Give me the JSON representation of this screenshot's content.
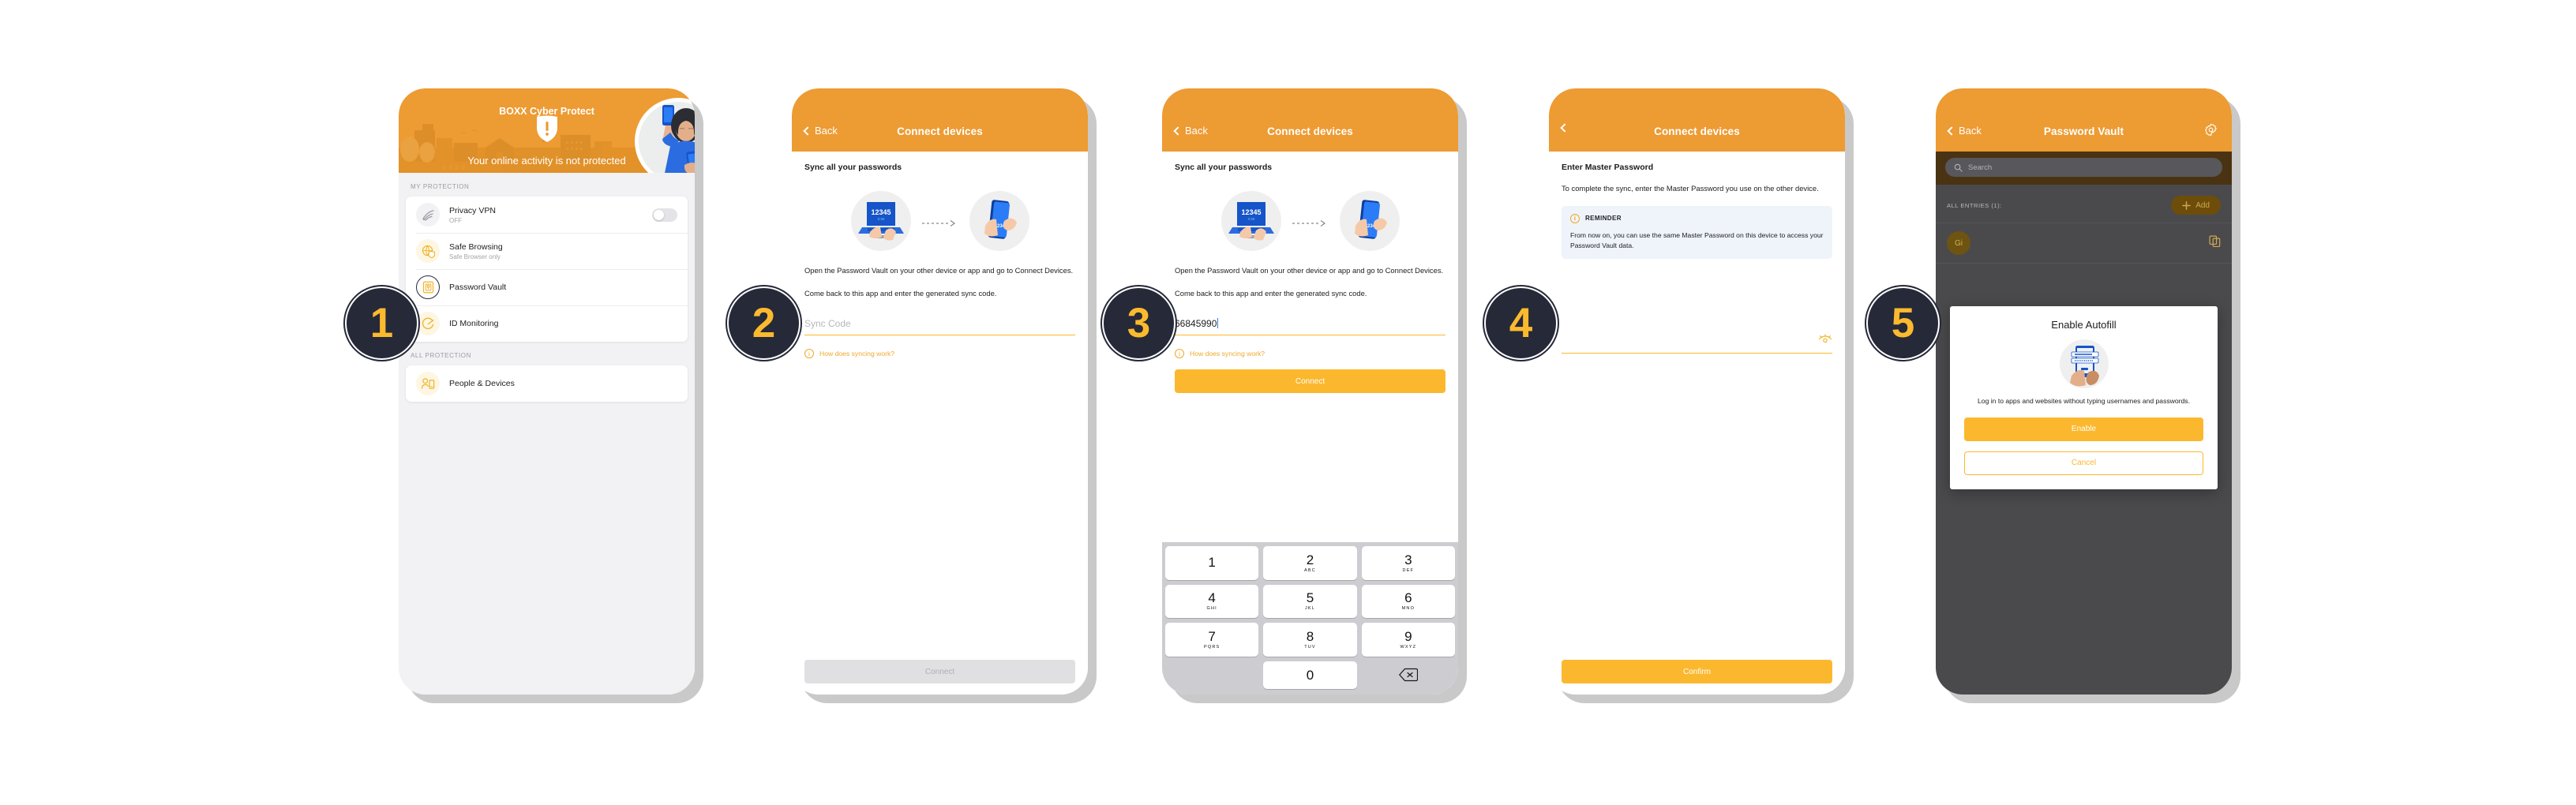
{
  "steps": [
    {
      "number": "1"
    },
    {
      "number": "2"
    },
    {
      "number": "3"
    },
    {
      "number": "4"
    },
    {
      "number": "5"
    }
  ],
  "screen1": {
    "hero_title": "BOXX Cyber Protect",
    "hero_status": "Your online activity is not protected",
    "section_my_protection": "MY PROTECTION",
    "section_all_protection": "ALL PROTECTION",
    "items": [
      {
        "title": "Privacy VPN",
        "subtitle": "OFF",
        "icon": "wifi-icon",
        "toggle": "off"
      },
      {
        "title": "Safe Browsing",
        "subtitle": "Safe Browser only",
        "icon": "globe-shield-icon"
      },
      {
        "title": "Password Vault",
        "subtitle": "",
        "icon": "vault-icon"
      },
      {
        "title": "ID Monitoring",
        "subtitle": "",
        "icon": "monitor-icon"
      }
    ],
    "all_items": [
      {
        "title": "People & Devices",
        "icon": "people-devices-icon"
      }
    ]
  },
  "screen2": {
    "nav_back": "Back",
    "nav_title": "Connect devices",
    "heading": "Sync all your passwords",
    "illustration_code": "12345",
    "illustration_timer": "0:59",
    "step_one": "Open the Password Vault on your other device or app and go to Connect Devices.",
    "step_two": "Come back to this app and enter the generated sync code.",
    "input_placeholder": "Sync Code",
    "input_value": "",
    "helper_link": "How does syncing work?",
    "cta": "Connect",
    "cta_state": "disabled"
  },
  "screen3": {
    "nav_back": "Back",
    "nav_title": "Connect devices",
    "heading": "Sync all your passwords",
    "illustration_code": "12345",
    "illustration_timer": "0:59",
    "step_one": "Open the Password Vault on your other device or app and go to Connect Devices.",
    "step_two": "Come back to this app and enter the generated sync code.",
    "input_value": "66845990",
    "helper_link": "How does syncing work?",
    "cta": "Connect",
    "cta_state": "enabled",
    "keypad": [
      {
        "num": "1",
        "letters": ""
      },
      {
        "num": "2",
        "letters": "ABC"
      },
      {
        "num": "3",
        "letters": "DEF"
      },
      {
        "num": "4",
        "letters": "GHI"
      },
      {
        "num": "5",
        "letters": "JKL"
      },
      {
        "num": "6",
        "letters": "MNO"
      },
      {
        "num": "7",
        "letters": "PQRS"
      },
      {
        "num": "8",
        "letters": "TUV"
      },
      {
        "num": "9",
        "letters": "WXYZ"
      },
      {
        "num": "0",
        "letters": ""
      }
    ],
    "keypad_delete_icon": "backspace-icon"
  },
  "screen4": {
    "nav_title": "Connect devices",
    "heading": "Enter Master Password",
    "body": "To complete the sync, enter the Master Password you use on the other device.",
    "reminder_label": "REMINDER",
    "reminder_body": "From now on, you can use the same Master Password on this device to access your Password Vault data.",
    "password_value": "",
    "reveal_icon": "eye-icon",
    "cta": "Confirm"
  },
  "screen5": {
    "nav_back": "Back",
    "nav_title": "Password Vault",
    "settings_icon": "gear-icon",
    "search_placeholder": "Search",
    "entries_label": "ALL ENTRIES (1):",
    "add_label": "Add",
    "entry_avatar": "Gi",
    "copy_icon": "copy-icon",
    "modal": {
      "title": "Enable Autofill",
      "body": "Log in to apps and websites without typing usernames and passwords.",
      "primary": "Enable",
      "secondary": "Cancel"
    }
  },
  "colors": {
    "orange": "#ED9B33",
    "yellow": "#FBB82E",
    "dark": "#262938",
    "blue": "#1554C9",
    "vault_bg": "#4a4a4d"
  }
}
